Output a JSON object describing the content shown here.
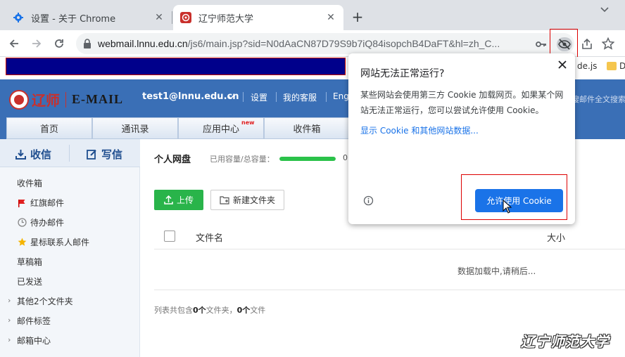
{
  "browser": {
    "tabs": [
      {
        "title": "设置 - 关于 Chrome",
        "active": false
      },
      {
        "title": "辽宁师范大学",
        "active": true
      }
    ],
    "new_tab_symbol": "+",
    "url_host": "webmail.lnnu.edu.cn",
    "url_path": "/js6/main.jsp?sid=N0dAaCN87D79S9b7iQ84isopchB4DaFT&hl=zh_C...",
    "bookmarks": [
      {
        "label": "de.js"
      },
      {
        "label": "D"
      }
    ]
  },
  "mail": {
    "logo_text": "辽师",
    "logo_email": "E-MAIL",
    "user": "test1@lnnu.edu.cn",
    "top_links": [
      "设置",
      "我的客服",
      "Eng"
    ],
    "search_hint": "搜邮件全文搜索",
    "nav_tabs": [
      {
        "label": "首页"
      },
      {
        "label": "通讯录"
      },
      {
        "label": "应用中心",
        "badge": "new"
      },
      {
        "label": "收件箱"
      }
    ],
    "side_actions": {
      "receive": "收信",
      "compose": "写信"
    },
    "side_items": [
      {
        "label": "收件箱",
        "icon": ""
      },
      {
        "label": "红旗邮件",
        "icon": "red-flag-icon"
      },
      {
        "label": "待办邮件",
        "icon": "clock-icon"
      },
      {
        "label": "星标联系人邮件",
        "icon": "star-icon"
      },
      {
        "label": "草稿箱",
        "icon": ""
      },
      {
        "label": "已发送",
        "icon": ""
      },
      {
        "label": "其他2个文件夹",
        "icon": "",
        "expandable": true
      },
      {
        "label": "邮件标签",
        "icon": "",
        "expandable": true
      },
      {
        "label": "邮箱中心",
        "icon": "",
        "expandable": true
      }
    ],
    "disk": {
      "title": "个人网盘",
      "usage_label": "已用容量/总容量：",
      "usage_fraction": 1.0,
      "usage_text": "0",
      "upload_label": "上传",
      "newfolder_label": "新建文件夹",
      "col_name": "文件名",
      "col_size": "大小",
      "loading": "数据加载中,请稍后...",
      "summary_prefix": "列表共包含",
      "summary_folders": "0个",
      "summary_mid": "文件夹，",
      "summary_files": "0个",
      "summary_suffix": "文件"
    },
    "watermark": "辽宁师范大学"
  },
  "cookie_popup": {
    "title": "网站无法正常运行?",
    "body": "某些网站会使用第三方 Cookie 加载网页。如果某个网站无法正常运行，您可以尝试允许使用 Cookie。",
    "link": "显示 Cookie 和其他网站数据...",
    "button": "允许使用 Cookie"
  },
  "colors": {
    "mail_header": "#3a6fb6",
    "popup_button": "#1a73e8",
    "upload_button": "#29b44a",
    "highlight": "#dd0000"
  }
}
